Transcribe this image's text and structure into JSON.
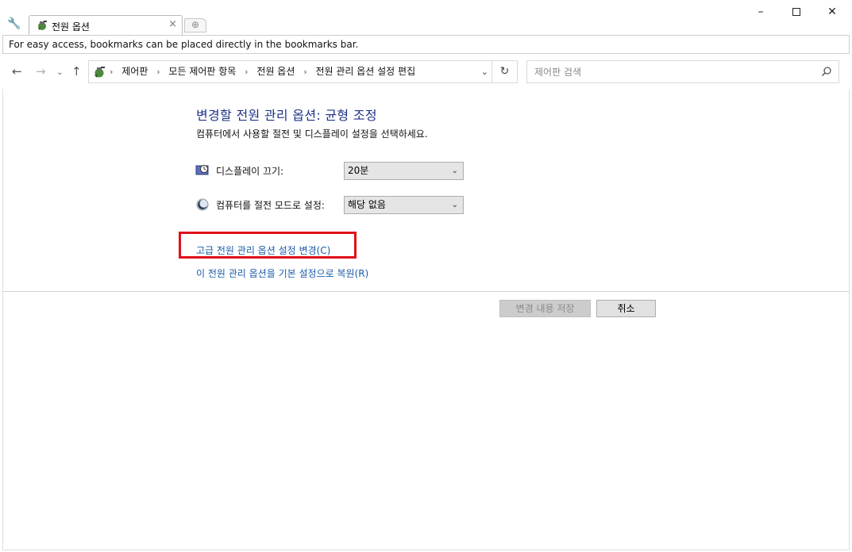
{
  "tab": {
    "title": "전원 옵션"
  },
  "window_controls": {
    "minimize": "–",
    "close": "✕"
  },
  "bookmarks_bar": {
    "text": "For easy access, bookmarks can be placed directly in the bookmarks bar."
  },
  "navigation": {
    "back": "←",
    "forward": "→",
    "recent": "⌄",
    "up": "↑",
    "refresh": "↻",
    "breadcrumbs": [
      "제어판",
      "모든 제어판 항목",
      "전원 옵션",
      "전원 관리 옵션 설정 편집"
    ],
    "search_placeholder": "제어판 검색"
  },
  "page": {
    "title": "변경할 전원 관리 옵션: 균형 조정",
    "subtitle": "컴퓨터에서 사용할 절전 및 디스플레이 설정을 선택하세요.",
    "settings": [
      {
        "label": "디스플레이 끄기:",
        "value": "20분",
        "icon": "display-timer-icon"
      },
      {
        "label": "컴퓨터를 절전 모드로 설정:",
        "value": "해당 없음",
        "icon": "sleep-moon-icon"
      }
    ],
    "advanced_link": "고급 전원 관리 옵션 설정 변경(C)",
    "restore_link": "이 전원 관리 옵션을 기본 설정으로 복원(R)",
    "save_button": "변경 내용 저장",
    "cancel_button": "취소"
  },
  "colors": {
    "title_blue": "#1e3287",
    "link_blue": "#1a5ba8",
    "highlight_red": "#e0101a"
  }
}
